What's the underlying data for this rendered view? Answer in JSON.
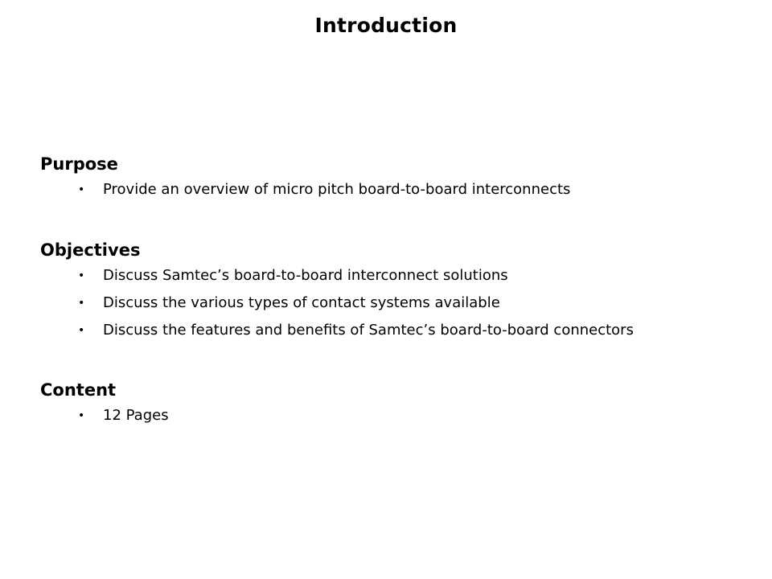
{
  "slide": {
    "title": "Introduction",
    "sections": [
      {
        "heading": "Purpose",
        "bullets": [
          "Provide an overview of micro pitch board-to-board interconnects"
        ]
      },
      {
        "heading": "Objectives",
        "bullets": [
          "Discuss Samtec’s board-to-board interconnect solutions",
          "Discuss the various types of contact systems available",
          "Discuss the features and benefits of Samtec’s board-to-board connectors"
        ]
      },
      {
        "heading": "Content",
        "bullets": [
          "12 Pages"
        ]
      }
    ],
    "bullet_glyph": "•"
  }
}
